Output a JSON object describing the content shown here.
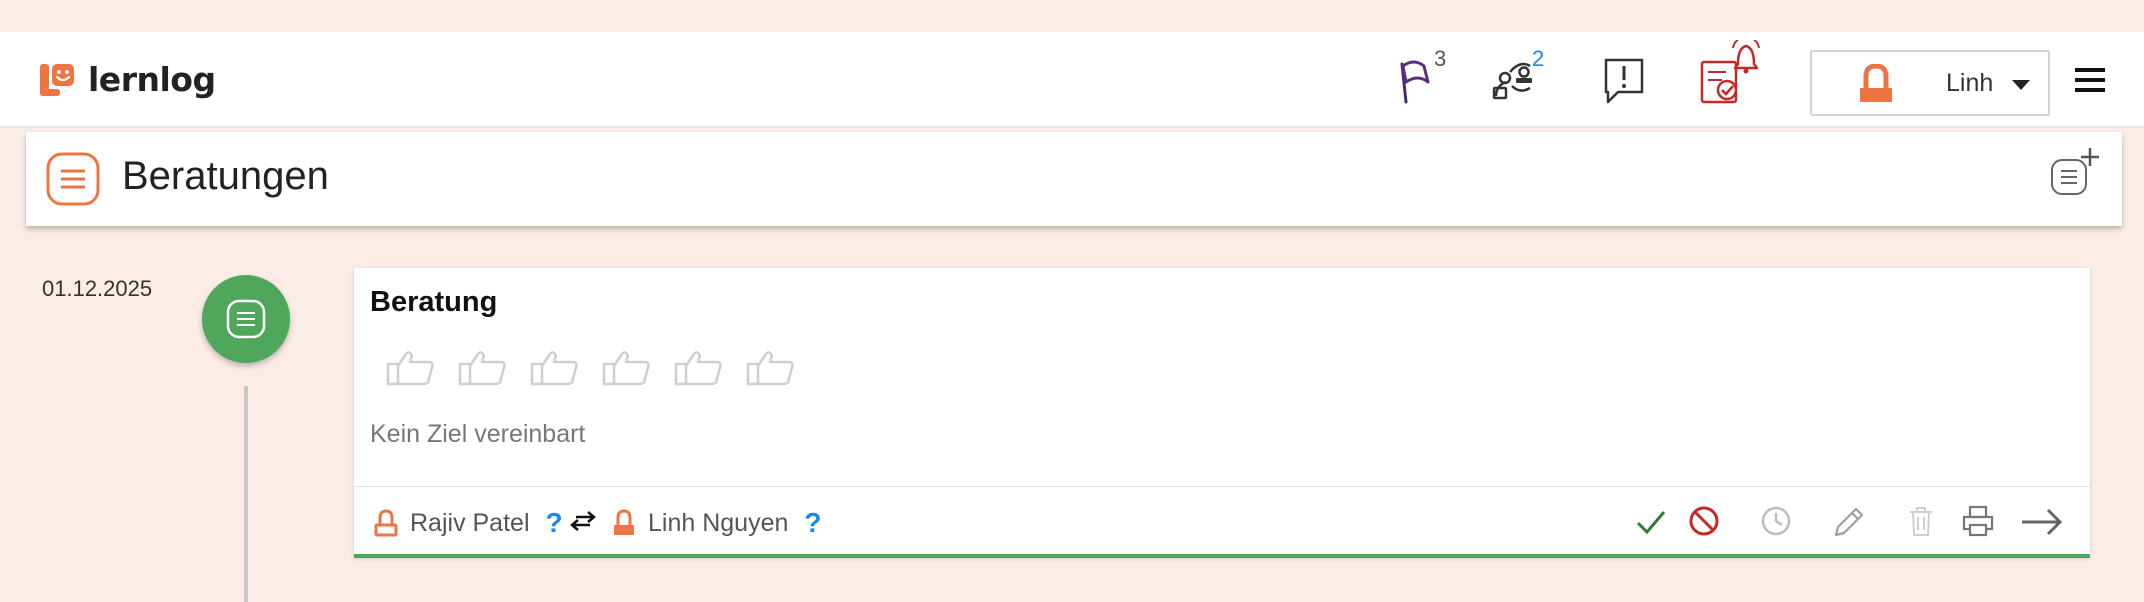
{
  "app": {
    "name": "lernlog"
  },
  "header": {
    "flags_count": "3",
    "mentor_requests_count": "2",
    "user_name": "Linh"
  },
  "page": {
    "title": "Beratungen"
  },
  "entries": [
    {
      "date": "01.12.2025",
      "title": "Beratung",
      "goal": "Kein Ziel vereinbart",
      "rating_max": 6,
      "participants": [
        {
          "name": "Rajiv Patel",
          "status": "?"
        },
        {
          "name": "Linh Nguyen",
          "status": "?"
        }
      ]
    }
  ],
  "colors": {
    "accent": "#ee7444",
    "success": "#4ea75a",
    "danger": "#c62828",
    "info": "#1e88e5",
    "background": "#fbece8"
  },
  "icons": {
    "flag": "flag-icon",
    "mentor": "mentor-request-icon",
    "feedback": "feedback-icon",
    "reminder": "task-reminder-icon",
    "menu": "hamburger-icon",
    "new": "new-consultation-icon",
    "approve": "check-icon",
    "reject": "forbidden-icon",
    "postpone": "clock-icon",
    "edit": "pencil-icon",
    "delete": "trash-icon",
    "print": "print-icon",
    "open": "arrow-right-icon",
    "swap": "swap-icon"
  }
}
